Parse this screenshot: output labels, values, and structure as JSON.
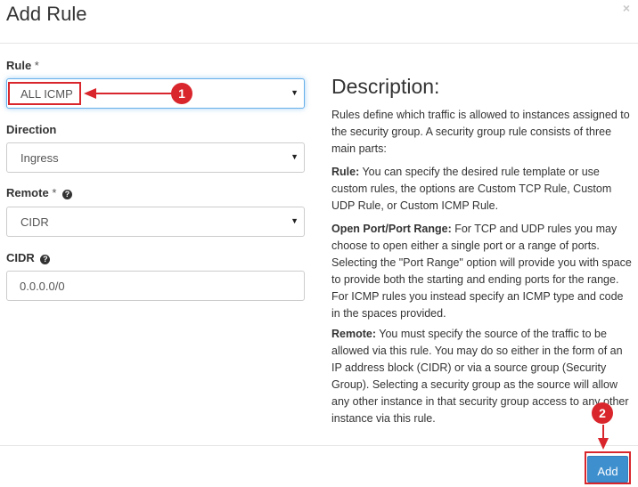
{
  "dialog": {
    "title": "Add Rule",
    "close_glyph": "×"
  },
  "form": {
    "rule": {
      "label": "Rule",
      "required_mark": "*",
      "value": "ALL ICMP"
    },
    "direction": {
      "label": "Direction",
      "value": "Ingress"
    },
    "remote": {
      "label": "Remote",
      "required_mark": "*",
      "value": "CIDR"
    },
    "cidr": {
      "label": "CIDR",
      "value": "0.0.0.0/0"
    },
    "select_caret": "▼",
    "help_glyph": "?"
  },
  "description": {
    "title": "Description:",
    "intro": "Rules define which traffic is allowed to instances assigned to the security group. A security group rule consists of three main parts:",
    "rule_heading": "Rule:",
    "rule_text": " You can specify the desired rule template or use custom rules, the options are Custom TCP Rule, Custom UDP Rule, or Custom ICMP Rule.",
    "port_heading": "Open Port/Port Range:",
    "port_text": " For TCP and UDP rules you may choose to open either a single port or a range of ports. Selecting the \"Port Range\" option will provide you with space to provide both the starting and ending ports for the range. For ICMP rules you instead specify an ICMP type and code in the spaces provided.",
    "remote_heading": "Remote:",
    "remote_text": " You must specify the source of the traffic to be allowed via this rule. You may do so either in the form of an IP address block (CIDR) or via a source group (Security Group). Selecting a security group as the source will allow any other instance in that security group access to any other instance via this rule."
  },
  "footer": {
    "add_label": "Add"
  },
  "annotations": {
    "step1": "1",
    "step2": "2",
    "accent_color": "#d9262c"
  }
}
